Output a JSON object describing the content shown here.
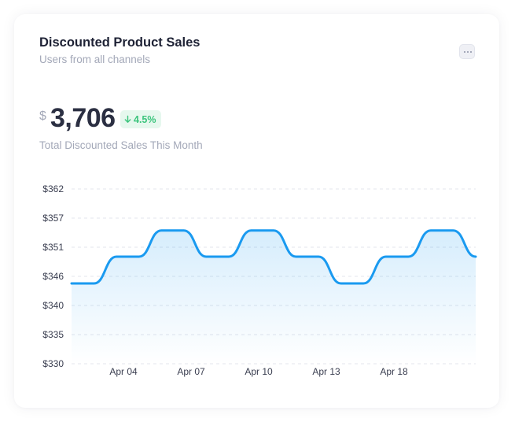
{
  "card": {
    "title": "Discounted Product Sales",
    "subtitle": "Users from all channels",
    "menu_icon": "more-horizontal-icon"
  },
  "summary": {
    "currency": "$",
    "value": "3,706",
    "change": "4.5%",
    "change_direction": "down",
    "change_icon": "arrow-down-icon",
    "caption": "Total Discounted Sales This Month"
  },
  "colors": {
    "line": "#1a9af0",
    "badge_text": "#3bc47c",
    "badge_bg": "#e6f8ee"
  },
  "chart_data": {
    "type": "area",
    "title": "",
    "xlabel": "",
    "ylabel": "",
    "y_tick_labels": [
      "$330",
      "$335",
      "$340",
      "$346",
      "$351",
      "$357",
      "$362"
    ],
    "x_tick_labels": [
      "Apr 04",
      "Apr 07",
      "Apr 10",
      "Apr 13",
      "Apr 18"
    ],
    "ylim": [
      330,
      362
    ],
    "grid": true,
    "series": [
      {
        "values": [
          344.7,
          344.7,
          349.6,
          349.6,
          354.4,
          354.4,
          349.6,
          349.6,
          354.4,
          354.4,
          349.6,
          349.6,
          344.7,
          344.7,
          349.6,
          349.6,
          354.4,
          354.4,
          349.6
        ]
      }
    ]
  }
}
